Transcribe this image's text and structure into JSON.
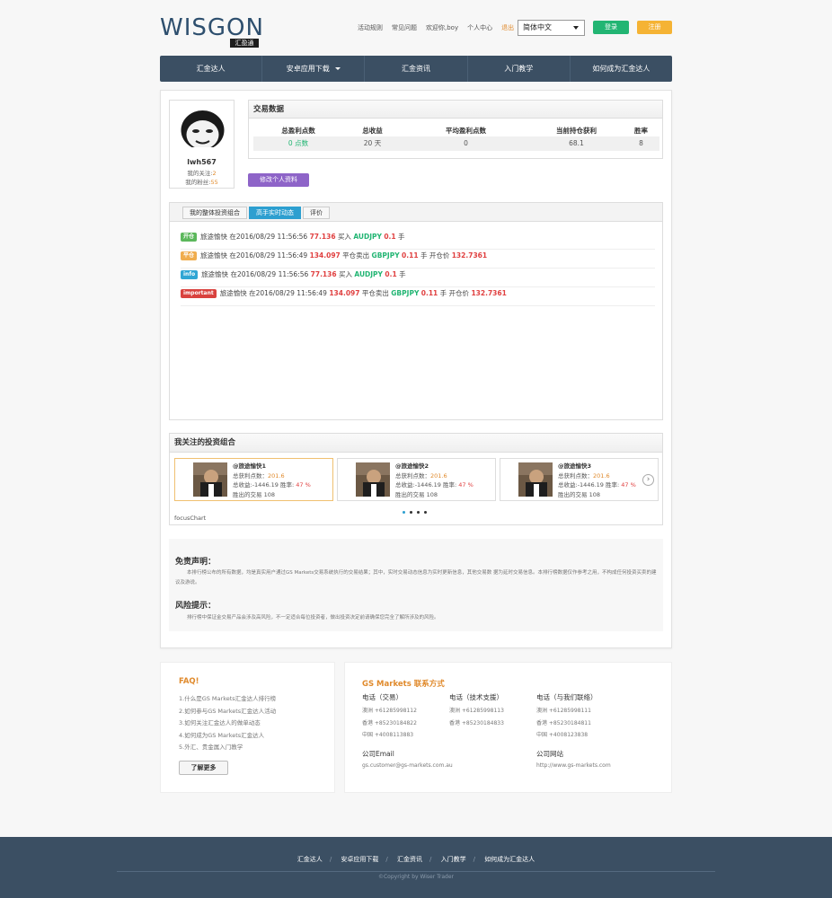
{
  "brand": {
    "logo_text": "WISGON",
    "logo_sub": "汇盈通"
  },
  "toplinks": {
    "rules": "活动规则",
    "faq": "常见问题",
    "welcome": "欢迎你,boy",
    "center": "个人中心",
    "logout": "退出"
  },
  "lang": {
    "selected": "简体中文"
  },
  "auth": {
    "login": "登录",
    "register": "注册"
  },
  "nav": {
    "items": [
      "汇金达人",
      "安卓应用下载",
      "汇金资讯",
      "入门教学",
      "如何成为汇金达人"
    ]
  },
  "profile": {
    "username": "lwh567",
    "follow_label": "我的关注:",
    "follow_count": "2",
    "fans_label": "我的粉丝:",
    "fans_count": "55",
    "edit_button": "修改个人资料"
  },
  "trade": {
    "title": "交易数据",
    "headers": [
      "总盈利点数",
      "总收益",
      "平均盈利点数",
      "当前持仓获利",
      "胜率"
    ],
    "values": [
      "0 点数",
      "20 天",
      "0",
      "68.1",
      "8"
    ]
  },
  "activity": {
    "tabs": [
      "我的整体投资组合",
      "高手实时动态",
      "评价"
    ],
    "rows": [
      {
        "label": "开仓",
        "label_color": "#5cb85c",
        "user": "旅途愉快",
        "time": "在2016/08/29 11:56:56",
        "price": "77.136",
        "action": "买入",
        "symbol": "AUDJPY",
        "qty": "0.1",
        "unit": "手",
        "extra": "",
        "close_price": ""
      },
      {
        "label": "平仓",
        "label_color": "#f0ad4e",
        "user": "旅途愉快",
        "time": "在2016/08/29 11:56:49",
        "price": "134.097",
        "action": "平仓卖出",
        "symbol": "GBPJPY",
        "qty": "0.11",
        "unit": "手",
        "extra": "开仓价",
        "close_price": "132.7361"
      },
      {
        "label": "info",
        "label_color": "#31a6d4",
        "user": "旅途愉快",
        "time": "在2016/08/29 11:56:56",
        "price": "77.136",
        "action": "买入",
        "symbol": "AUDJPY",
        "qty": "0.1",
        "unit": "手",
        "extra": "",
        "close_price": ""
      },
      {
        "label": "important",
        "label_color": "#d9423e",
        "user": "旅途愉快",
        "time": "在2016/08/29 11:56:49",
        "price": "134.097",
        "action": "平仓卖出",
        "symbol": "GBPJPY",
        "qty": "0.11",
        "unit": "手",
        "extra": "开仓价",
        "close_price": "132.7361"
      }
    ]
  },
  "following": {
    "title": "我关注的投资组合",
    "cards": [
      {
        "name": "@旅途愉快1",
        "points_label": "总获利点数：",
        "points": "201.6",
        "profit": "总收益:-1446.19 胜率:",
        "rate": "47 %",
        "trades": "胜出的交易 108"
      },
      {
        "name": "@旅途愉快2",
        "points_label": "总获利点数：",
        "points": "201.6",
        "profit": "总收益:-1446.19 胜率:",
        "rate": "47 %",
        "trades": "胜出的交易 108"
      },
      {
        "name": "@旅途愉快3",
        "points_label": "总获利点数：",
        "points": "201.6",
        "profit": "总收益:-1446.19 胜率:",
        "rate": "47 %",
        "trades": "胜出的交易 108"
      }
    ],
    "focus_label": "focusChart"
  },
  "disclaimer": {
    "title1": "免责声明：",
    "text1": "本排行榜公布的所有数据，均是真实用户通过GS Markets交易系统执行的交易结果；其中，实时交易动态信息为实时更新信息，其他交易数 据为延时交易信息。本排行榜数据仅作参考之用，不构成任何投资买卖的建议及游说。",
    "title2": "风险提示：",
    "text2": "排行榜中保证金交易产品会涉及高风险，不一定适合每位投资者，做出投资决定前请确保您完全了解所涉及的风险。"
  },
  "faq": {
    "title": "FAQ!",
    "items": [
      "1.什么是GS Markets汇金达人排行榜",
      "2.如何参与GS Markets汇金达人活动",
      "3.如何关注汇金达人的做单动态",
      "4.如何成为GS Markets汇金达人",
      "5.外汇、贵金属入门教学"
    ],
    "more": "了解更多"
  },
  "contact": {
    "title": "GS Markets 联系方式",
    "col1_title": "电话（交易）",
    "col1": [
      "澳洲 +61285998112",
      "香港 +85230184822",
      "中国 +4008113883"
    ],
    "col2_title": "电话（技术支援）",
    "col2": [
      "澳洲 +61285998113",
      "香港 +85230184833"
    ],
    "col3_title": "电话（与我们联络）",
    "col3": [
      "澳洲 +61285998111",
      "香港 +85230184811",
      "中国 +4008123838"
    ],
    "email_title": "公司Email",
    "email": "gs.customer@gs-markets.com.au",
    "web_title": "公司网站",
    "web": "http://www.gs-markets.com"
  },
  "footer": {
    "links": [
      "汇金达人",
      "安卓应用下载",
      "汇金资讯",
      "入门教学",
      "如何成为汇金达人"
    ],
    "copyright": "©Copyright by Wiser Trader"
  }
}
